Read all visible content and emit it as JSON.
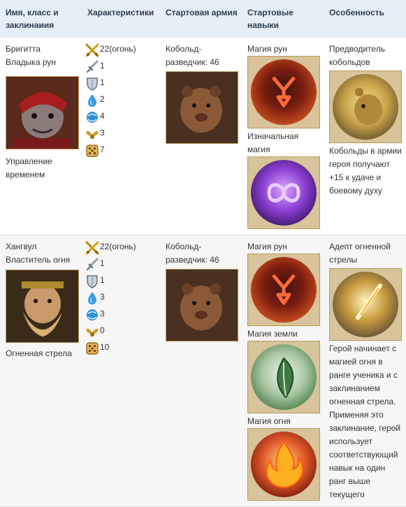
{
  "headers": [
    "Имя, класс и заклинаиия",
    "Характеристики",
    "Стартовая армия",
    "Стартовые навыки",
    "Особенность"
  ],
  "heroes": [
    {
      "name": "Бригитта",
      "class": "Владыка рун",
      "spell": "Управление временем",
      "stats": [
        "22(огонь)",
        "1",
        "1",
        "2",
        "4",
        "3",
        "7"
      ],
      "army": "Кобольд-разведчик: 46",
      "skills": [
        "Магия рун",
        "Изначальная магия"
      ],
      "specialty_title": "Предводитель кобольдов",
      "specialty_desc": "Кобольды в армии героя получают +15 к удаче и боевому духу"
    },
    {
      "name": "Хангвул",
      "class": "Властитель огня",
      "spell": "Огненная стрела",
      "stats": [
        "22(огонь)",
        "1",
        "1",
        "3",
        "3",
        "0",
        "10"
      ],
      "army": "Кобольд-разведчик: 46",
      "skills": [
        "Магия рун",
        "Магия земли",
        "Магия огня"
      ],
      "specialty_title": "Адепт огненной стрелы",
      "specialty_desc": "Герой начинает с магией огня в ранге ученика и с заклинанием огненная стрела. Применяя это заклинание, герой использует соответствующий навык на один ранг выше текущего"
    }
  ],
  "stat_icons": [
    "crossed-swords-icon",
    "sword-icon",
    "shield-icon",
    "knowledge-drop-icon",
    "spellpower-orb-icon",
    "morale-wings-icon",
    "luck-dice-icon"
  ]
}
